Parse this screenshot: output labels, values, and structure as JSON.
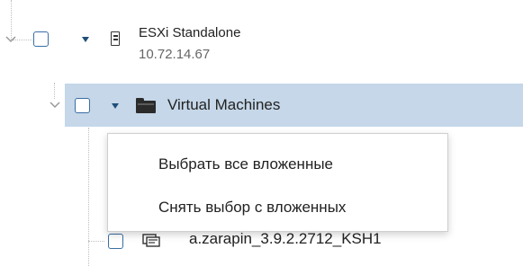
{
  "tree": {
    "host": {
      "name": "ESXi Standalone",
      "address": "10.72.14.67",
      "icon": "server-icon"
    },
    "folder": {
      "name": "Virtual Machines",
      "icon": "folder-icon"
    },
    "vm": {
      "name": "a.zarapin_3.9.2.2712_KSH1",
      "icon": "vm-icon"
    }
  },
  "context_menu": {
    "items": [
      {
        "label": "Выбрать все вложенные"
      },
      {
        "label": "Снять выбор с вложенных"
      }
    ]
  },
  "colors": {
    "selection": "#c5d7e8",
    "checkbox_border": "#3a6ea5",
    "caret": "#1f4e79"
  }
}
